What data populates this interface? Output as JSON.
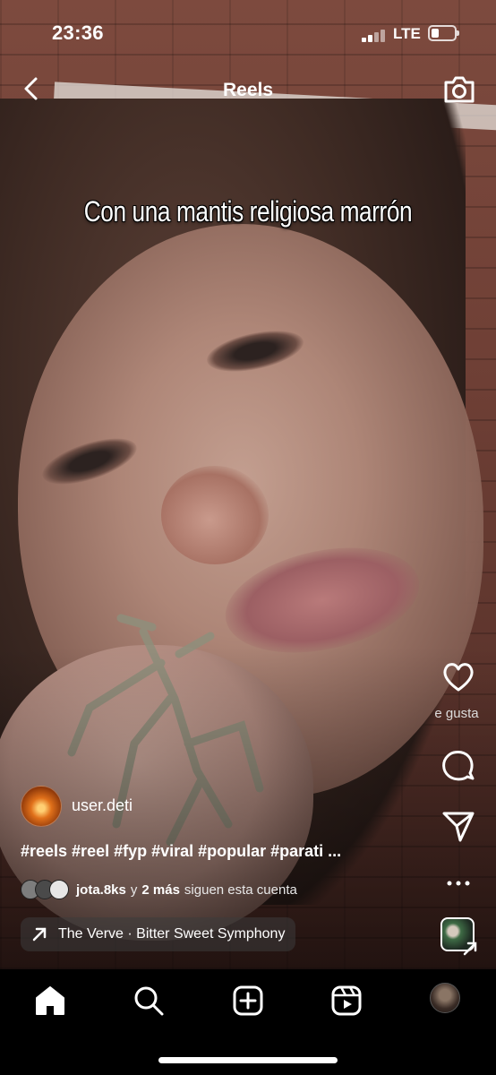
{
  "status_bar": {
    "time": "23:36",
    "network": "LTE",
    "battery_level": 0.35
  },
  "header": {
    "title": "Reels",
    "back_icon": "chevron-left-icon",
    "camera_icon": "camera-icon"
  },
  "video": {
    "caption_overlay": "Con una mantis religiosa marrón"
  },
  "actions": {
    "like_label": "e gusta",
    "icons": [
      "heart-icon",
      "comment-icon",
      "send-icon",
      "more-icon"
    ]
  },
  "post": {
    "username": "user.deti",
    "hashtags": "#reels #reel #fyp #viral #popular #parati ...",
    "followers": {
      "first": "jota.8ks",
      "connector": "y",
      "others": "2 más",
      "suffix": "siguen esta cuenta"
    },
    "audio": "The Verve · Bitter Sweet Symphony"
  },
  "bottom_nav": {
    "items": [
      "home-icon",
      "search-icon",
      "create-icon",
      "reels-icon",
      "profile-avatar"
    ],
    "active": "home-icon"
  },
  "colors": {
    "background": "#000000",
    "text": "#ffffff",
    "pill_bg": "#3c3c3c"
  }
}
